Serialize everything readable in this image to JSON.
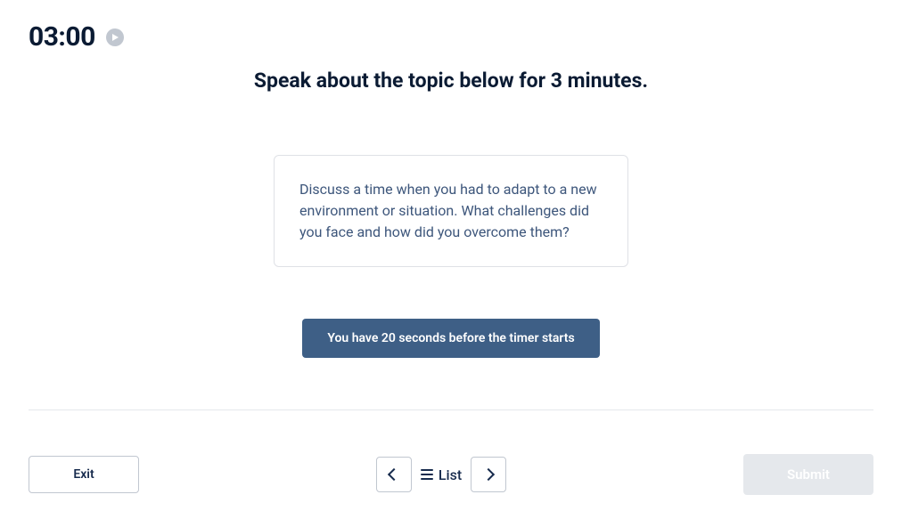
{
  "timer": {
    "value": "03:00"
  },
  "instruction": "Speak about the topic below for 3 minutes.",
  "topic": {
    "prompt": "Discuss a time when you had to adapt to a new environment or situation. What challenges did you face and how did you overcome them?"
  },
  "countdown_banner": "You have 20 seconds before the timer starts",
  "footer": {
    "exit_label": "Exit",
    "list_label": "List",
    "submit_label": "Submit"
  }
}
